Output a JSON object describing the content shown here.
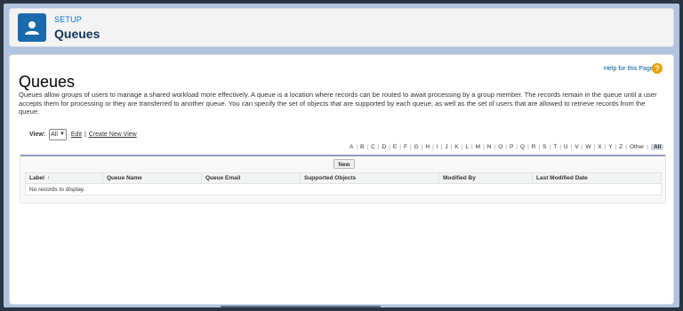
{
  "header": {
    "section": "SETUP",
    "title": "Queues",
    "icon": "user-icon",
    "accent": "#1a6aad"
  },
  "main": {
    "title": "Queues",
    "help_link": "Help for this Page",
    "help_icon": "?",
    "description": "Queues allow groups of users to manage a shared workload more effectively. A queue is a location where records can be routed to await processing by a group member. The records remain in the queue until a user accepts them for processing or they are transferred to another queue. You can specify the set of objects that are supported by each queue, as well as the set of users that are allowed to retrieve records from the queue."
  },
  "view": {
    "label": "View:",
    "selected": "All",
    "edit": "Edit",
    "separator": "|",
    "create": "Create New View"
  },
  "alphabet": {
    "letters": [
      "A",
      "B",
      "C",
      "D",
      "E",
      "F",
      "G",
      "H",
      "I",
      "J",
      "K",
      "L",
      "M",
      "N",
      "O",
      "P",
      "Q",
      "R",
      "S",
      "T",
      "U",
      "V",
      "W",
      "X",
      "Y",
      "Z",
      "Other"
    ],
    "active": "All"
  },
  "list": {
    "new_button": "New",
    "columns": [
      "Label",
      "Queue Name",
      "Queue Email",
      "Supported Objects",
      "Modified By",
      "Last Modified Date"
    ],
    "sort_indicator": "↑",
    "empty_message": "No records to display."
  }
}
